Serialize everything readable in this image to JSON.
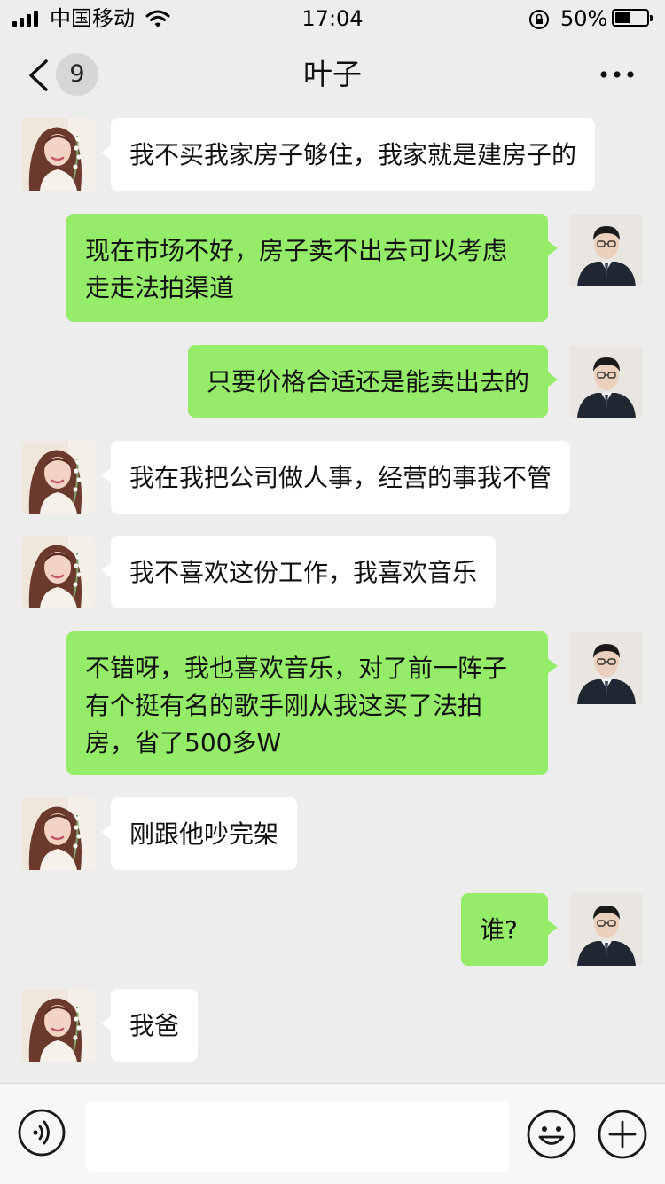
{
  "status_bar": {
    "carrier": "中国移动",
    "time": "17:04",
    "battery_percent": "50%",
    "battery_level": 0.5
  },
  "nav": {
    "unread_count": "9",
    "title": "叶子"
  },
  "messages": [
    {
      "side": "in",
      "text": "我不买我家房子够住，我家就是建房子的"
    },
    {
      "side": "out",
      "text": "现在市场不好，房子卖不出去可以考虑走走法拍渠道"
    },
    {
      "side": "out",
      "text": "只要价格合适还是能卖出去的"
    },
    {
      "side": "in",
      "text": "我在我把公司做人事，经营的事我不管"
    },
    {
      "side": "in",
      "text": "我不喜欢这份工作，我喜欢音乐"
    },
    {
      "side": "out",
      "text": "不错呀，我也喜欢音乐，对了前一阵子有个挺有名的歌手刚从我这买了法拍房，省了500多W"
    },
    {
      "side": "in",
      "text": "刚跟他吵完架"
    },
    {
      "side": "out",
      "text": "谁?"
    },
    {
      "side": "in",
      "text": "我爸"
    }
  ],
  "input_bar": {
    "voice_icon": "voice-icon",
    "emoji_icon": "emoji-icon",
    "more_icon": "plus-icon",
    "input_value": ""
  },
  "colors": {
    "background": "#ededed",
    "incoming_bubble": "#ffffff",
    "outgoing_bubble": "#95ec69"
  }
}
